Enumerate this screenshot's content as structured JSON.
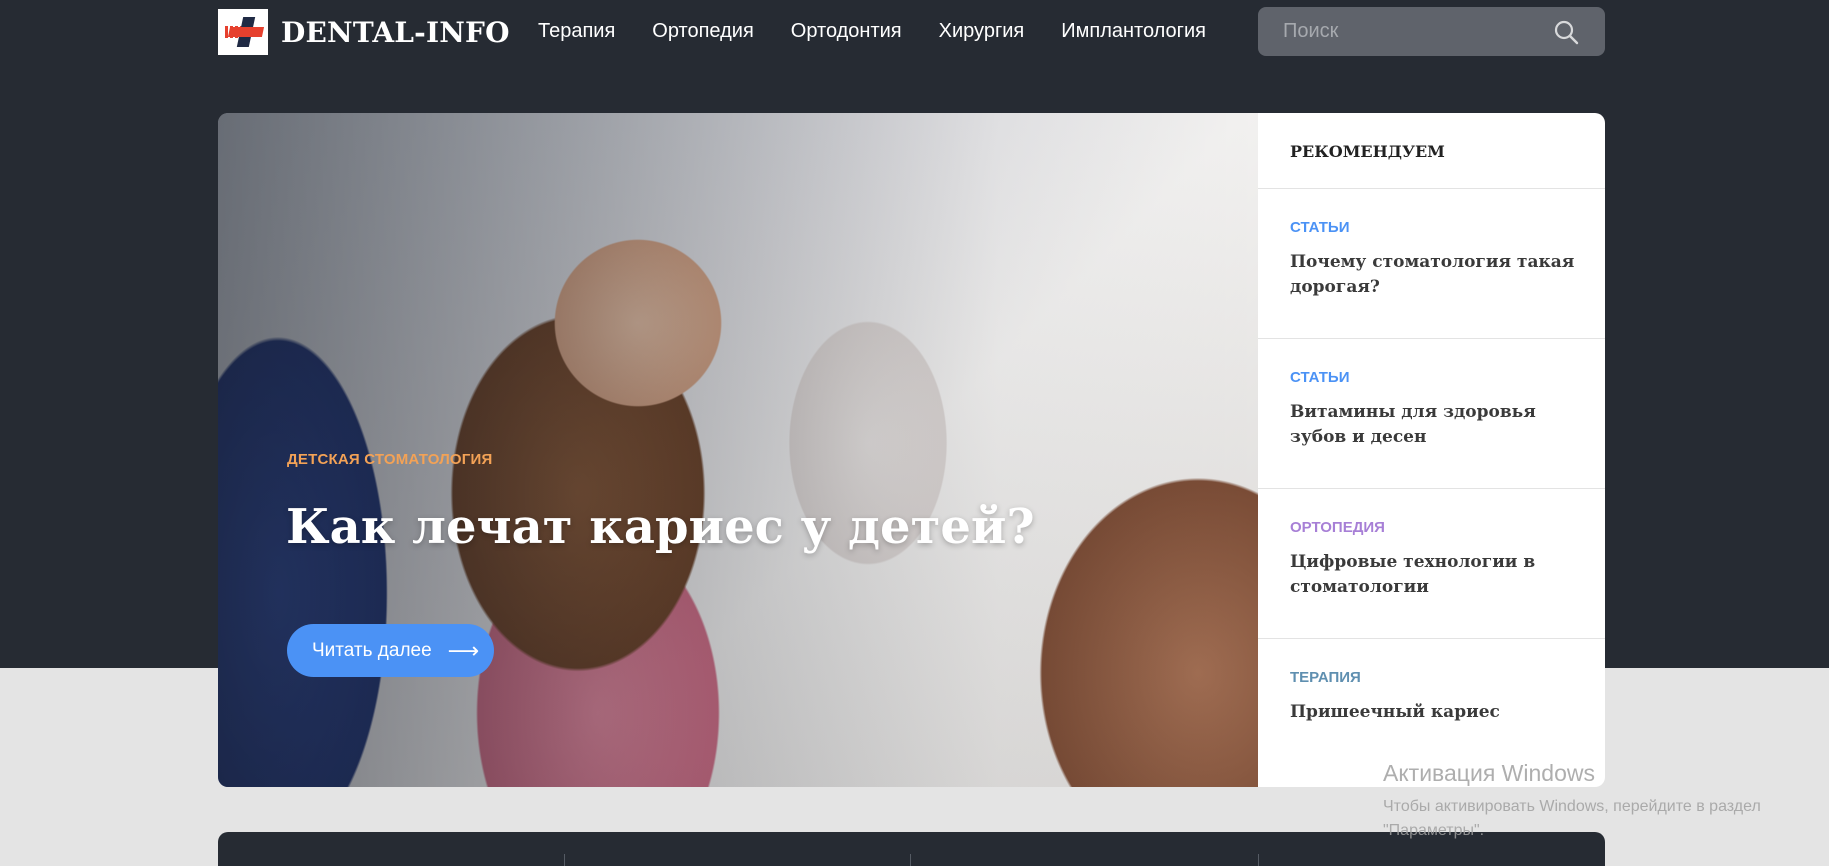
{
  "header": {
    "logo_text": "DENTAL-INFO",
    "nav": [
      "Терапия",
      "Ортопедия",
      "Ортодонтия",
      "Хирургия",
      "Имплантология"
    ],
    "search_placeholder": "Поиск"
  },
  "hero": {
    "category": "Детская стоматология",
    "title": "Как лечат кариес у детей?",
    "button_label": "Читать далее",
    "button_arrow": "⟶"
  },
  "recommended": {
    "heading": "РЕКОМЕНДУЕМ",
    "items": [
      {
        "category": "Статьи",
        "title": "Почему стоматология такая дорогая?"
      },
      {
        "category": "Статьи",
        "title": "Витамины для здоровья зубов и десен"
      },
      {
        "category": "Ортопедия",
        "title": "Цифровые технологии в стоматологии"
      },
      {
        "category": "Терапия",
        "title": "Пришеечный кариес"
      }
    ]
  },
  "watermark": {
    "title": "Активация Windows",
    "line1": "Чтобы активировать Windows, перейдите в раздел",
    "line2": "\"Параметры\"."
  },
  "colors": {
    "header_bg": "#262b33",
    "accent_blue": "#4b92f5",
    "category_orange": "#f3a256",
    "cat_articles": "#4b92f5",
    "cat_orthopedics": "#a77fd6",
    "cat_therapy": "#5f8fb0"
  }
}
